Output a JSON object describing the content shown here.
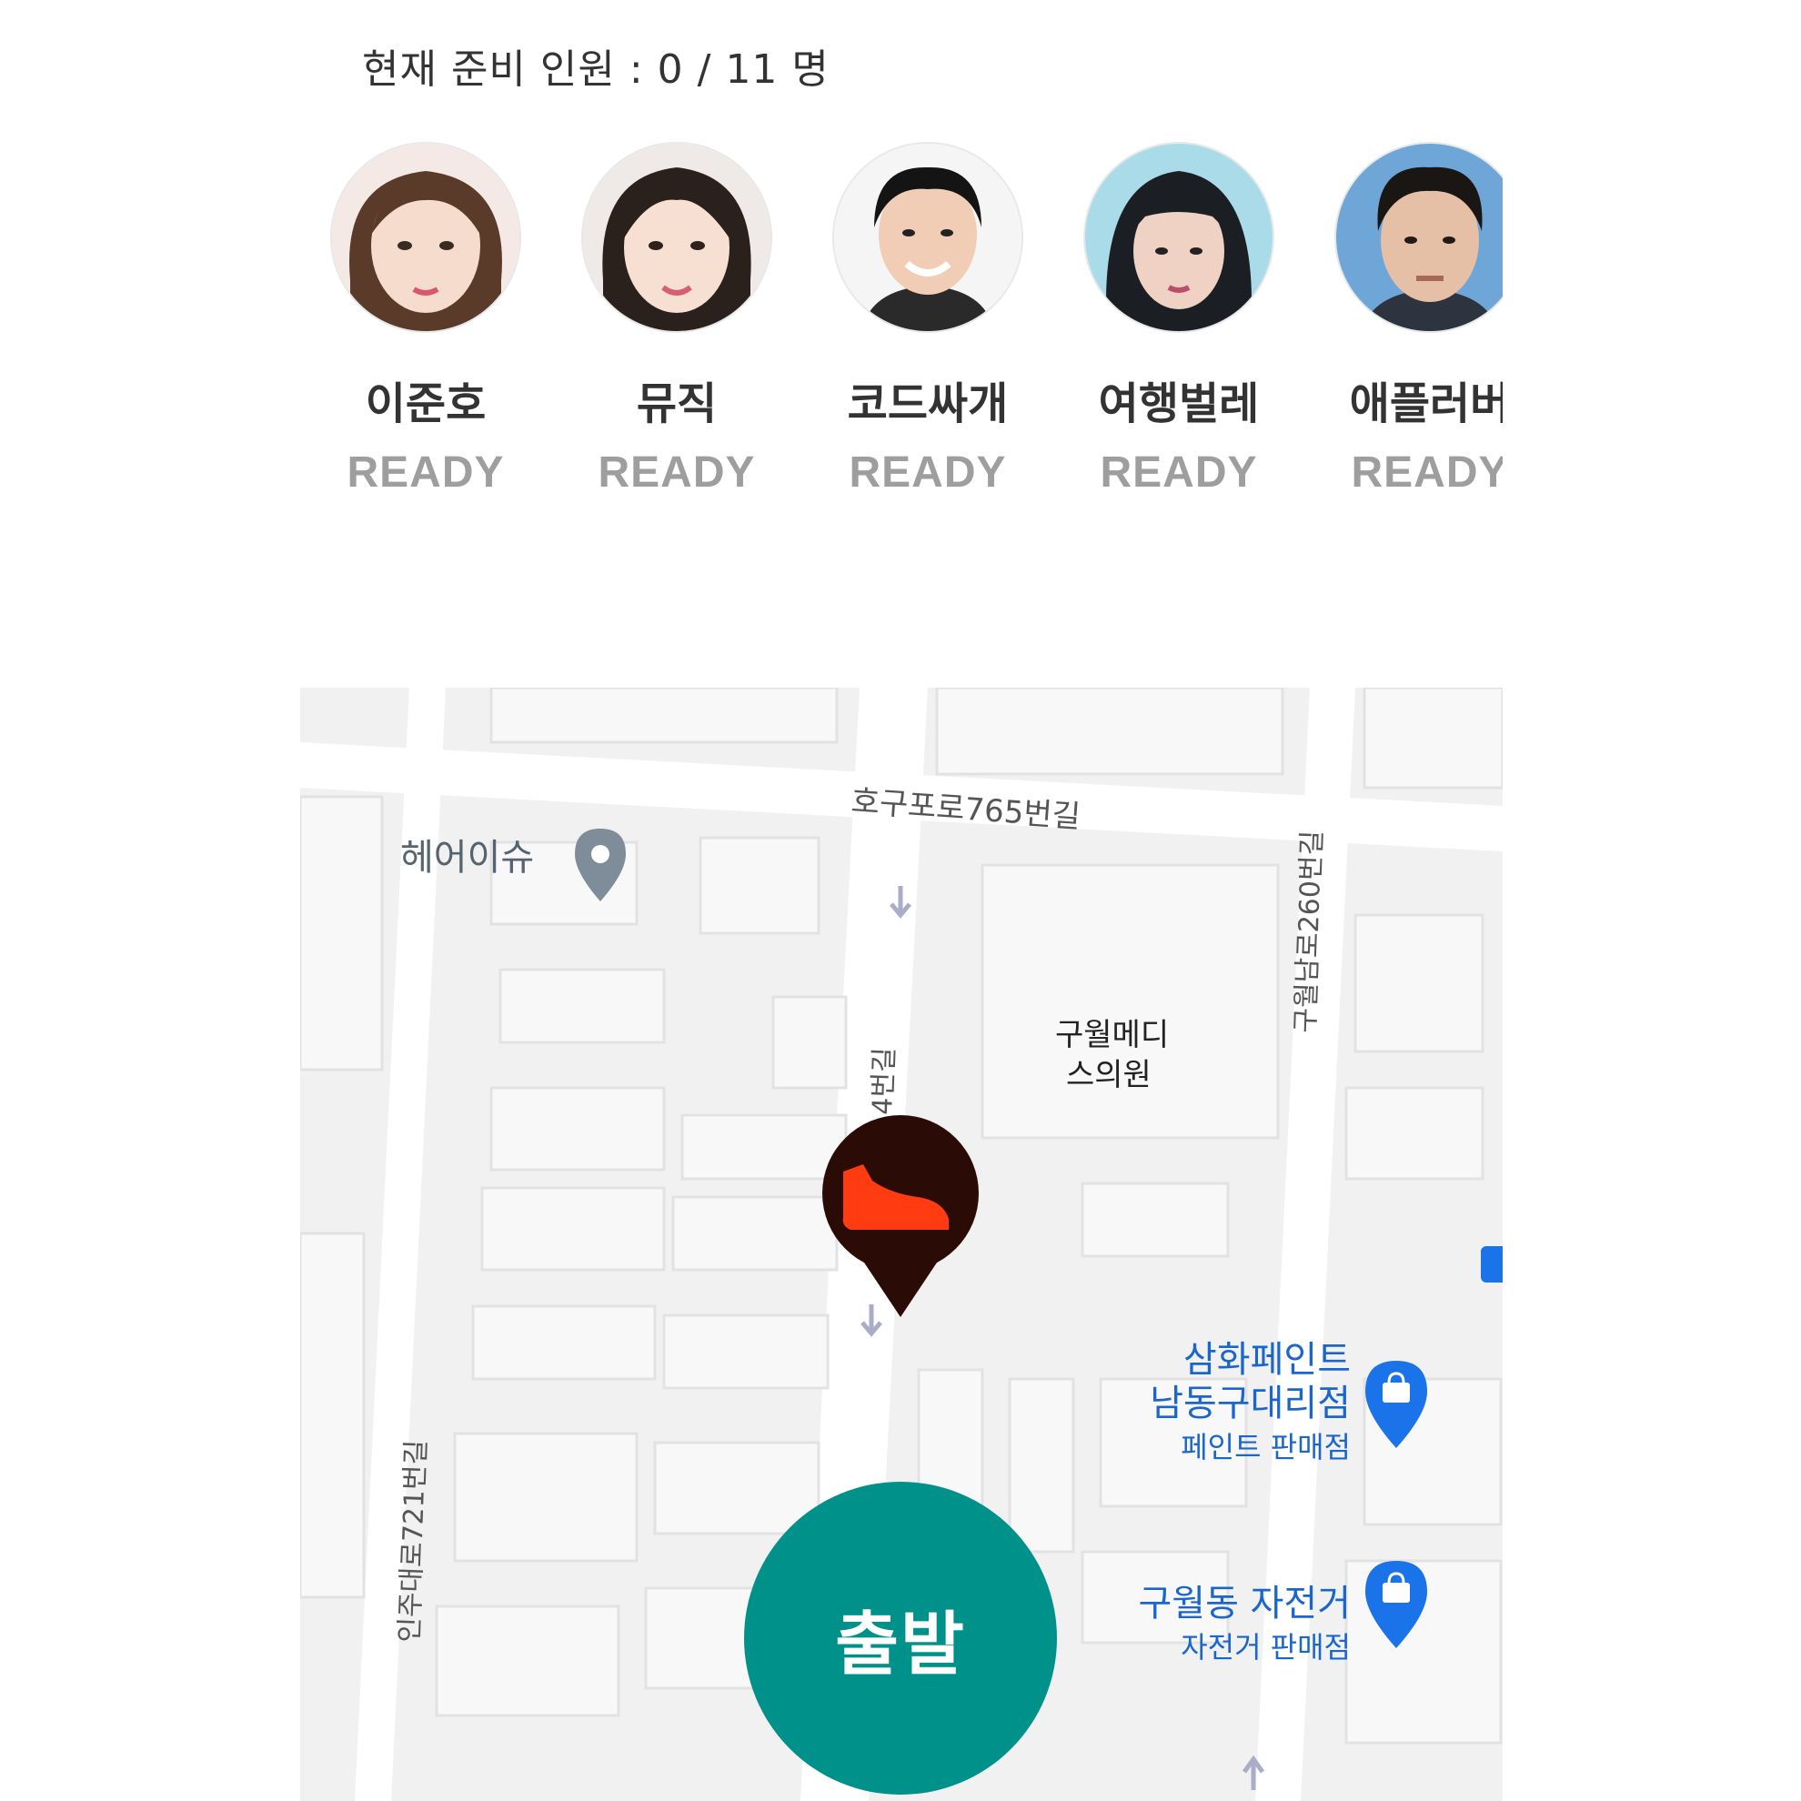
{
  "header": {
    "ready_count": "현재 준비 인원 : 0 / 11 명"
  },
  "members": [
    {
      "name": "이준호",
      "status": "READY"
    },
    {
      "name": "뮤직",
      "status": "READY"
    },
    {
      "name": "코드싸개",
      "status": "READY"
    },
    {
      "name": "여행벌레",
      "status": "READY"
    },
    {
      "name": "애플러버",
      "status": "READY"
    }
  ],
  "map": {
    "road_labels": [
      "호구포로765번길",
      "구월남로260번길",
      "인주대로721번길",
      "4번길"
    ],
    "places": [
      {
        "name": "헤어이슈",
        "icon": "location-pin-icon"
      },
      {
        "name": "구월메디\n스의원",
        "icon": ""
      },
      {
        "name": "삼화페인트\n남동구대리점",
        "category": "페인트 판매점",
        "icon": "shopping-bag-pin-icon"
      },
      {
        "name": "구월동 자전거",
        "category": "자전거 판매점",
        "icon": "shopping-bag-pin-icon"
      }
    ],
    "marker_icon": "sneaker-marker-icon",
    "colors": {
      "marker": "#2b0b05",
      "shoe": "#ff3b12",
      "poi": "#1a73e8",
      "poi_label": "#1a66cc"
    }
  },
  "actions": {
    "start_label": "출발",
    "start_color": "#00918a"
  }
}
